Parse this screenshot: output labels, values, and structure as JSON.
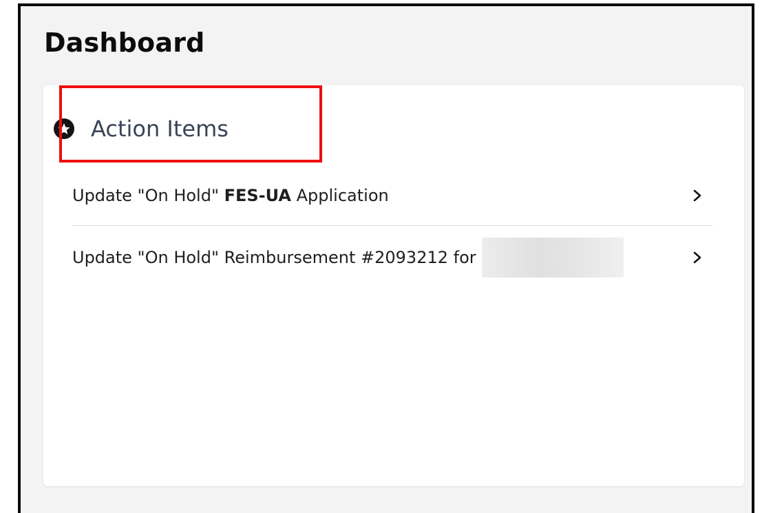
{
  "dashboard": {
    "title": "Dashboard"
  },
  "action_items": {
    "title": "Action Items",
    "header_icon": "star-in-circle",
    "items": [
      {
        "prefix": "Update \"On Hold\" ",
        "bold": "FES-UA",
        "suffix": " Application",
        "chevron_icon": "chevron-right"
      },
      {
        "text": "Update \"On Hold\" Reimbursement #2093212 for",
        "redacted": true,
        "chevron_icon": "chevron-right"
      }
    ]
  },
  "colors": {
    "highlight_border": "#ee0d0d",
    "frame_background": "#f3f3f3",
    "card_background": "#ffffff",
    "title_text": "#0c0c0c",
    "card_title_text": "#3a4456"
  }
}
